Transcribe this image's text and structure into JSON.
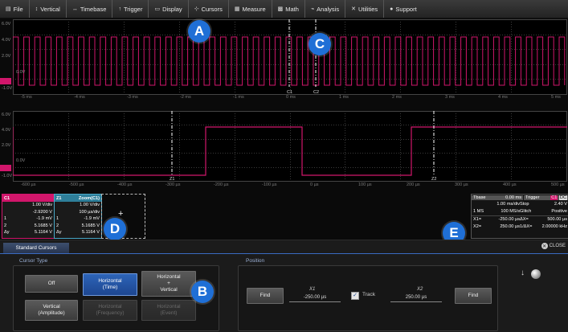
{
  "menu": [
    {
      "icon": "file-icon",
      "glyph": "▤",
      "label": "File"
    },
    {
      "icon": "vertical-icon",
      "glyph": "↕",
      "label": "Vertical"
    },
    {
      "icon": "timebase-icon",
      "glyph": "↔",
      "label": "Timebase"
    },
    {
      "icon": "trigger-icon",
      "glyph": "↑",
      "label": "Trigger"
    },
    {
      "icon": "display-icon",
      "glyph": "▭",
      "label": "Display"
    },
    {
      "icon": "cursors-icon",
      "glyph": "⊹",
      "label": "Cursors"
    },
    {
      "icon": "measure-icon",
      "glyph": "▦",
      "label": "Measure"
    },
    {
      "icon": "math-icon",
      "glyph": "▩",
      "label": "Math"
    },
    {
      "icon": "analysis-icon",
      "glyph": "⌁",
      "label": "Analysis"
    },
    {
      "icon": "utilities-icon",
      "glyph": "✕",
      "label": "Utilities"
    },
    {
      "icon": "support-icon",
      "glyph": "●",
      "label": "Support"
    }
  ],
  "top_grid": {
    "volt_labels": [
      "6.0V",
      "4.0V",
      "2.0V",
      "0.0V",
      "-1.0V"
    ],
    "time_labels": [
      "-5 ms",
      "-4 ms",
      "-3 ms",
      "-2 ms",
      "-1 ms",
      "0 ms",
      "1 ms",
      "2 ms",
      "3 ms",
      "4 ms",
      "5 ms"
    ],
    "cursor_labels": [
      "C1",
      "C2"
    ]
  },
  "zoom_grid": {
    "volt_labels": [
      "6.0V",
      "4.0V",
      "2.0V",
      "0.0V",
      "-1.0V"
    ],
    "time_labels": [
      "-600 µs",
      "-500 µs",
      "-400 µs",
      "-300 µs",
      "-200 µs",
      "-100 µs",
      "0 µs",
      "100 µs",
      "200 µs",
      "300 µs",
      "400 µs",
      "500 µs"
    ],
    "cursor_labels": [
      "Z1",
      "Z2"
    ]
  },
  "trace_c1": {
    "title": "C1",
    "rows": [
      [
        "",
        "1.00 V/div"
      ],
      [
        "",
        "-2.9200 V"
      ],
      [
        "1",
        "-1.9 mV"
      ],
      [
        "2",
        "5.1685 V"
      ],
      [
        "Δy",
        "5.1164 V"
      ]
    ]
  },
  "trace_z1": {
    "title": "Z1",
    "subtitle": "Zoom(C1)",
    "rows": [
      [
        "",
        "1.00 V/div"
      ],
      [
        "",
        "100 µs/div"
      ],
      [
        "1",
        "-1.9 mV"
      ],
      [
        "2",
        "5.1685 V"
      ],
      [
        "Δy",
        "5.1164 V"
      ]
    ]
  },
  "timebase_box": {
    "tbase_label": "Tbase",
    "tbase_val": "0.00 ms",
    "trigger_label": "Trigger",
    "trigger_badges": [
      "C1",
      "DC"
    ],
    "rows": [
      [
        "",
        "1.00 ms/div",
        "Stop",
        "2.40 V"
      ],
      [
        "1 MS",
        "100 MS/s",
        "Glitch",
        "Positive"
      ]
    ],
    "cursor_rows": [
      [
        "X1=",
        "-250.00 µs",
        "ΔX=",
        "500.00 µs"
      ],
      [
        "X2=",
        "250.00 µs",
        "1/ΔX=",
        "2.00000 kHz"
      ]
    ]
  },
  "callouts": [
    "A",
    "B",
    "C",
    "D",
    "E"
  ],
  "dialog": {
    "tab": "Standard Cursors",
    "close": "CLOSE",
    "cursor_type_label": "Cursor Type",
    "position_label": "Position",
    "buttons": {
      "off": "Off",
      "horizontal_time": [
        "Horizontal",
        "(Time)"
      ],
      "horizontal_vertical": [
        "Horizontal",
        "+",
        "Vertical"
      ],
      "vertical_amplitude": [
        "Vertical",
        "(Amplitude)"
      ],
      "horizontal_frequency": [
        "Horizontal",
        "(Frequency)"
      ],
      "horizontal_event": [
        "Horizontal",
        "(Event)"
      ]
    },
    "find1": "Find",
    "find2": "Find",
    "x1_label": "X1",
    "x1_value": "-250.00 µs",
    "track_label": "Track",
    "x2_label": "X2",
    "x2_value": "250.00 µs",
    "arrow": "↓"
  },
  "colors": {
    "trace": "#d1166b",
    "cursor": "#ffffff",
    "selected_button": "#2d64b8",
    "callout": "#1f6fd6",
    "grid": "#3a3a3a"
  }
}
